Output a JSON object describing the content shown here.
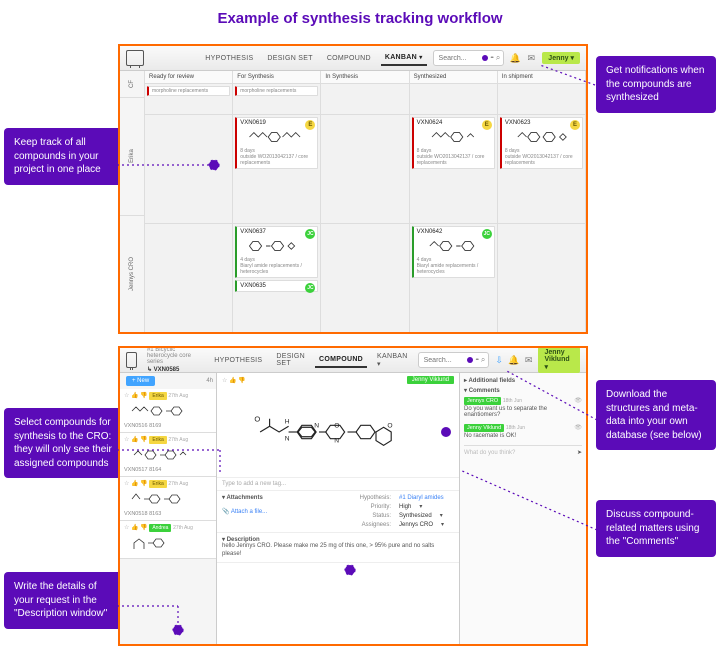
{
  "page_title": "Example of synthesis tracking workflow",
  "callouts": {
    "notifs": "Get notifications when the compounds are synthesized",
    "keep_track": "Keep track of all compounds in your project in one place",
    "select": "Select compounds for synthesis to the CRO: they will only see their assigned compounds",
    "details": "Write the details of your request in the \"Description window\"",
    "download": "Download the structures and meta-data into your own database (see below)",
    "discuss": "Discuss compound-related matters using the \"Comments\""
  },
  "panel1": {
    "tabs": {
      "hyp": "HYPOTHESIS",
      "design": "DESIGN SET",
      "compound": "COMPOUND",
      "kanban": "KANBAN"
    },
    "search_ph": "Search...",
    "user": "Jenny",
    "row_labels": {
      "cf": "CF",
      "erika": "Erika",
      "jennys": "Jennys CRO"
    },
    "cols": {
      "c1": "Ready for review",
      "c2": "For Synthesis",
      "c3": "In Synthesis",
      "c4": "Synthesized",
      "c5": "In shipment"
    },
    "review_meta": "morpholine replacements",
    "cards": {
      "r1c2": {
        "id": "VXN0619",
        "days": "8 days",
        "meta": "outside WO2013042137 / core replacements"
      },
      "r1c4": {
        "id": "VXN0624",
        "days": "8 days",
        "meta": "outside WO2013042137 / core replacements"
      },
      "r1c5": {
        "id": "VXN0623",
        "days": "8 days",
        "meta": "outside WO2013042137 / core replacements"
      },
      "r2c2a": {
        "id": "VXN0637",
        "days": "4 days",
        "meta": "Biaryl amide replacements / heterocycles"
      },
      "r2c2b": {
        "id": "VXN0635"
      },
      "r2c4": {
        "id": "VXN0642",
        "days": "4 days",
        "meta": "Biaryl amide replacements / heterocycles"
      }
    }
  },
  "panel2": {
    "breadcrumb_top": "#1 Bicyclic heterocycle core series",
    "breadcrumb_sub": "↳ VXN0585",
    "tabs": {
      "hyp": "HYPOTHESIS",
      "design": "DESIGN SET",
      "compound": "COMPOUND",
      "kanban": "KANBAN"
    },
    "search_ph": "Search...",
    "user": "Jenny Viklund",
    "newbtn": "+ New",
    "sort4h": "4h",
    "side": {
      "c1": {
        "tag": "Erika",
        "date": "27th Aug",
        "id": "VXN0516 8169"
      },
      "c2": {
        "tag": "Erika",
        "date": "27th Aug",
        "id": "VXN0517 8164"
      },
      "c3": {
        "tag": "Erika",
        "date": "27th Aug",
        "id": "VXN0518 8163"
      },
      "c4": {
        "tag": "Andrea",
        "date": "27th Aug"
      }
    },
    "main": {
      "author": "Jenny Viklund",
      "tag_ph": "Type to add a new tag...",
      "attach_h": "Attachments",
      "attach_link": "Attach a file...",
      "fields": {
        "hyp_k": "Hypothesis:",
        "hyp_v": "#1 Diaryl amides",
        "prio_k": "Priority:",
        "prio_v": "High",
        "stat_k": "Status:",
        "stat_v": "Synthesized",
        "assg_k": "Assignees:",
        "assg_v": "Jennys CRO"
      },
      "desc_h": "Description",
      "desc": "hello Jennys CRO. Please make me 25 mg of this one, > 95% pure and no salts please!"
    },
    "right": {
      "add_fields": "Additional fields",
      "comments_h": "Comments",
      "c1_who": "Jennys CRO",
      "c1_when": "18th Jun",
      "c1_txt": "Do you want us to separate the enantiomers?",
      "c2_who": "Jenny Viklund",
      "c2_when": "18th Jun",
      "c2_txt": "No racemate is OK!",
      "think": "What do you think?"
    }
  }
}
